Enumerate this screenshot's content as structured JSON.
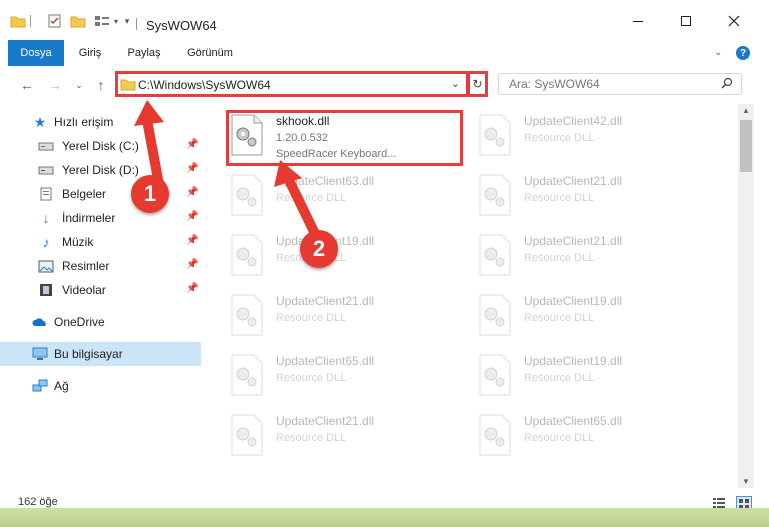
{
  "window": {
    "title": "SysWOW64",
    "controls": [
      "minimize-icon",
      "maximize-icon",
      "close-icon"
    ]
  },
  "ribbon": {
    "tabs": [
      {
        "label": "Dosya",
        "active": true
      },
      {
        "label": "Giriş",
        "active": false
      },
      {
        "label": "Paylaş",
        "active": false
      },
      {
        "label": "Görünüm",
        "active": false
      }
    ]
  },
  "address": {
    "path": "C:\\Windows\\SysWOW64"
  },
  "search": {
    "placeholder": "Ara: SysWOW64"
  },
  "sidebar": {
    "items": [
      {
        "label": "Hızlı erişim",
        "icon": "star-icon",
        "pinned": false
      },
      {
        "label": "Yerel Disk (C:)",
        "icon": "drive-icon",
        "pinned": true
      },
      {
        "label": "Yerel Disk (D:)",
        "icon": "drive-icon",
        "pinned": true
      },
      {
        "label": "Belgeler",
        "icon": "documents-icon",
        "pinned": true
      },
      {
        "label": "İndirmeler",
        "icon": "download-icon",
        "pinned": true
      },
      {
        "label": "Müzik",
        "icon": "music-icon",
        "pinned": true
      },
      {
        "label": "Resimler",
        "icon": "pictures-icon",
        "pinned": true
      },
      {
        "label": "Videolar",
        "icon": "videos-icon",
        "pinned": true
      },
      {
        "label": "OneDrive",
        "icon": "cloud-icon",
        "pinned": false
      },
      {
        "label": "Bu bilgisayar",
        "icon": "computer-icon",
        "pinned": false,
        "selected": true
      },
      {
        "label": "Ağ",
        "icon": "network-icon",
        "pinned": false
      }
    ]
  },
  "files": [
    {
      "name": "skhook.dll",
      "line2": "1.20.0.532",
      "line3": "SpeedRacer Keyboard...",
      "highlighted": true
    },
    {
      "name": "UpdateClient42.dll",
      "line2": "Resource DLL"
    },
    {
      "name": "UpdateClient63.dll",
      "line2": "Resource DLL"
    },
    {
      "name": "UpdateClient21.dll",
      "line2": "Resource DLL"
    },
    {
      "name": "UpdateClient19.dll",
      "line2": "Resource DLL"
    },
    {
      "name": "UpdateClient21.dll",
      "line2": "Resource DLL"
    },
    {
      "name": "UpdateClient21.dll",
      "line2": "Resource DLL"
    },
    {
      "name": "UpdateClient19.dll",
      "line2": "Resource DLL"
    },
    {
      "name": "UpdateClient65.dll",
      "line2": "Resource DLL"
    },
    {
      "name": "UpdateClient19.dll",
      "line2": "Resource DLL"
    },
    {
      "name": "UpdateClient21.dll",
      "line2": "Resource DLL"
    },
    {
      "name": "UpdateClient65.dll",
      "line2": "Resource DLL"
    }
  ],
  "status": {
    "item_count": "162 öğe"
  },
  "markers": [
    "1",
    "2"
  ],
  "colors": {
    "accent": "#1979ca",
    "highlight": "#e63c3c",
    "selection": "#cce4f7"
  }
}
